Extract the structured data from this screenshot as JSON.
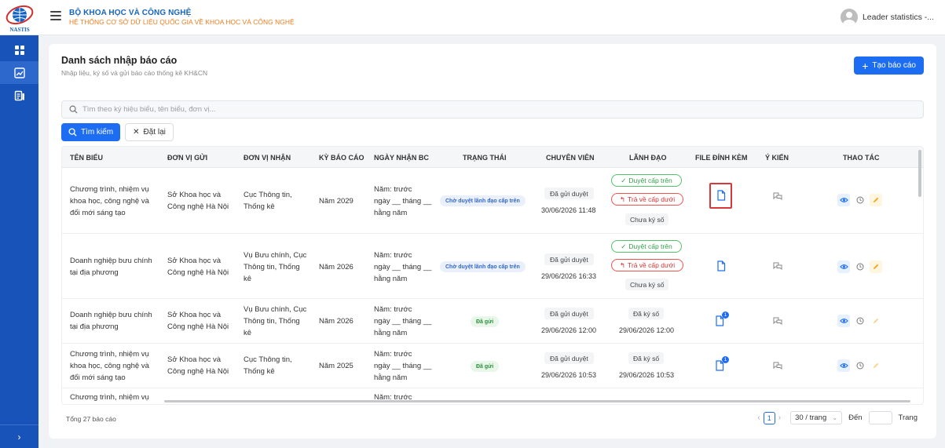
{
  "header": {
    "logo_text": "NASTIS",
    "org_title": "BỘ KHOA HỌC VÀ CÔNG NGHỆ",
    "org_subtitle": "HỆ THỐNG CƠ SỞ DỮ LIỆU QUỐC GIA VỀ KHOA HỌC VÀ CÔNG NGHỆ",
    "user_name": "Leader statistics -..."
  },
  "sidebar": {
    "items": [
      {
        "icon": "dashboard-icon"
      },
      {
        "icon": "chart-icon",
        "active": true
      },
      {
        "icon": "report-icon"
      }
    ],
    "toggle_label": "›"
  },
  "page": {
    "title": "Danh sách nhập báo cáo",
    "subtitle": "Nhập liệu, ký số và gửi báo cáo thống kê KH&CN",
    "create_label": "Tạo báo cáo"
  },
  "search": {
    "placeholder": "Tìm theo ký hiệu biểu, tên biểu, đơn vị...",
    "value": "",
    "search_label": "Tìm kiếm",
    "reset_label": "Đặt lại"
  },
  "table": {
    "columns": {
      "ten_bieu": "TÊN BIỂU",
      "don_vi_gui": "ĐƠN VỊ GỬI",
      "don_vi_nhan": "ĐƠN VỊ NHẬN",
      "ky_bao_cao": "KỲ BÁO CÁO",
      "ngay_nhan": "NGÀY NHẬN BC",
      "trang_thai": "TRẠNG THÁI",
      "chuyen_vien": "CHUYÊN VIÊN",
      "lanh_dao": "LÃNH ĐẠO",
      "file": "FILE ĐÍNH KÈM",
      "y_kien": "Ý KIẾN",
      "thao_tac": "THAO TÁC"
    },
    "actions": {
      "approve": "Duyệt cấp trên",
      "return": "Trả về cấp dưới"
    },
    "rows": [
      {
        "ten_bieu": [
          "Chương trình, nhiệm vụ",
          "khoa học, công nghệ và",
          "đổi mới sáng tạo"
        ],
        "don_vi_gui": [
          "Sở Khoa học và",
          "Công nghệ Hà Nội"
        ],
        "don_vi_nhan": [
          "Cục Thông tin,",
          "Thống kê"
        ],
        "ky_bao_cao": "Năm 2029",
        "ngay_nhan": [
          "Năm: trước",
          "ngày __ tháng __",
          "hằng năm"
        ],
        "trang_thai": "Chờ duyệt lãnh đạo cấp trên",
        "cv_status": "Đã gửi duyệt",
        "cv_time": "30/06/2026 11:48",
        "ld_status": "Chưa ký số"
      },
      {
        "ten_bieu": [
          "Doanh nghiệp bưu chính",
          "tại địa phương"
        ],
        "don_vi_gui": [
          "Sở Khoa học và",
          "Công nghệ Hà Nội"
        ],
        "don_vi_nhan": [
          "Vụ Bưu chính, Cục",
          "Thông tin, Thống",
          "kê"
        ],
        "ky_bao_cao": "Năm 2026",
        "ngay_nhan": [
          "Năm: trước",
          "ngày __ tháng __",
          "hằng năm"
        ],
        "trang_thai": "Chờ duyệt lãnh đạo cấp trên",
        "cv_status": "Đã gửi duyệt",
        "cv_time": "29/06/2026 16:33",
        "ld_status": "Chưa ký số"
      },
      {
        "ten_bieu": [
          "Doanh nghiệp bưu chính",
          "tại địa phương"
        ],
        "don_vi_gui": [
          "Sở Khoa học và",
          "Công nghệ Hà Nội"
        ],
        "don_vi_nhan": [
          "Vụ Bưu chính, Cục",
          "Thông tin, Thống",
          "kê"
        ],
        "ky_bao_cao": "Năm 2026",
        "ngay_nhan": [
          "Năm: trước",
          "ngày __ tháng __",
          "hằng năm"
        ],
        "trang_thai": "Đã gửi",
        "cv_status": "Đã gửi duyệt",
        "cv_time": "29/06/2026 12:00",
        "ld_status": "Đã ký số",
        "ld_time": "29/06/2026 12:00",
        "file_badge": "1"
      },
      {
        "ten_bieu": [
          "Chương trình, nhiệm vụ",
          "khoa học, công nghệ và",
          "đổi mới sáng tạo"
        ],
        "don_vi_gui": [
          "Sở Khoa học và",
          "Công nghệ Hà Nội"
        ],
        "don_vi_nhan": [
          "Cục Thông tin,",
          "Thống kê"
        ],
        "ky_bao_cao": "Năm 2025",
        "ngay_nhan": [
          "Năm: trước",
          "ngày __ tháng __",
          "hằng năm"
        ],
        "trang_thai": "Đã gửi",
        "cv_status": "Đã gửi duyệt",
        "cv_time": "29/06/2026 10:53",
        "ld_status": "Đã ký số",
        "ld_time": "29/06/2026 10:53",
        "file_badge": "1"
      },
      {
        "ten_bieu": [
          "Chương trình, nhiệm vụ"
        ],
        "ngay_nhan": [
          "Năm: trước"
        ]
      }
    ]
  },
  "footer": {
    "total": "Tổng 27 báo cáo",
    "current_page": "1",
    "page_size": "30 / trang",
    "goto_label": "Đến",
    "page_label": "Trang"
  },
  "colors": {
    "primary": "#1d6df2",
    "sidebar": "#1753b8",
    "org_title": "#1565c0",
    "org_subtitle": "#ef7c1a",
    "approve": "#2f9e46",
    "return": "#d32f2f",
    "highlight": "#d9383a"
  }
}
